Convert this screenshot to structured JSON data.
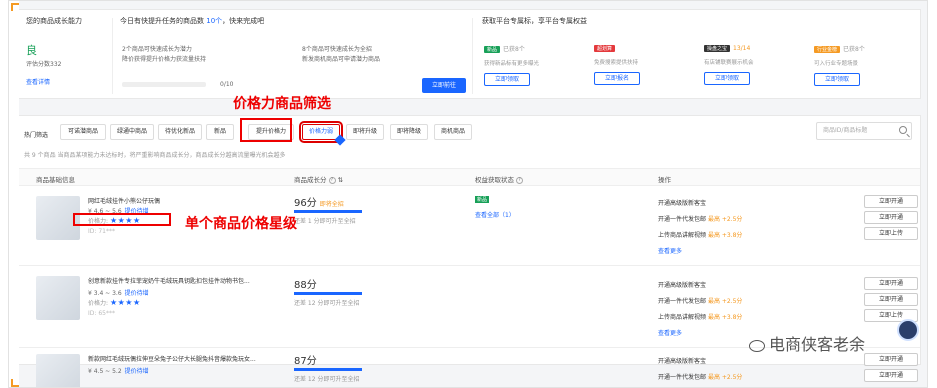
{
  "capability": {
    "title": "您的商品成长能力",
    "grade": "良",
    "score_label": "评估分数332",
    "detail_link": "查看详情"
  },
  "fast_growth": {
    "title_prefix": "今日有快提升任务的商品数",
    "count": "10个",
    "title_suffix": "，快来完成吧",
    "items": [
      "2个商品可快速成长为潜力",
      "8个商品可快速成长为全招",
      "降价获得提升价格力获流量扶持",
      "新发商机商品可申请潜力商品"
    ],
    "progress_value": 0,
    "progress_text": "0/10",
    "button": "立即前往"
  },
  "perks": {
    "title": "获取平台专属标，享平台专属权益",
    "items": [
      {
        "tag": "新品",
        "tag_color": "#18a058",
        "status": "已获8个",
        "highlight": "",
        "desc": "获得新品标有更多曝光",
        "button": "立即领取"
      },
      {
        "tag": "超划算",
        "tag_color": "#e4393c",
        "status": "",
        "highlight": "",
        "desc": "免费搜索提供扶持",
        "button": "立即报名"
      },
      {
        "tag": "操盘之宝",
        "tag_color": "#333333",
        "status": "13/14",
        "highlight": "13/14",
        "desc": "有店铺联赛展示机会",
        "button": "立即领取"
      },
      {
        "tag": "行业金榜",
        "tag_color": "#f59a23",
        "status": "已获8个",
        "highlight": "",
        "desc": "可入行业专题场景",
        "button": "立即领取"
      }
    ]
  },
  "filters": {
    "label": "热门筛选",
    "chips": [
      "可诺潜商品",
      "绿通中商品",
      "待优化新品",
      "新品",
      "提升价格力",
      "价格力弱",
      "即将升级",
      "即将降级",
      "商机商品"
    ],
    "highlighted_index": 4,
    "active_index": 5,
    "search_placeholder": "商品ID/商品标题",
    "count_text": "共 9 个商品 当商品某项能力未达标时，将严重影响商品成长分，商品成长分越高流量曝光机会越多"
  },
  "table": {
    "headers": [
      "商品基础信息",
      "商品成长分",
      "权益获取状态",
      "操作"
    ],
    "rows": [
      {
        "name": "网红毛绒挂件小熊公仔玩偶",
        "price": "¥ 4.6 ~ 5.6",
        "price_tip": "提价待增",
        "stars_label": "价格力:",
        "stars": "★★★★",
        "id": "ID: 71***",
        "score": "96分",
        "score_hot": "即将全招",
        "score_note": "还差 1 分即可升至全招",
        "rights_tag": "新品",
        "rights_link": "查看全部（1）",
        "ops": [
          {
            "text": "开通高级版新客宝",
            "hl": ""
          },
          {
            "text": "开通一件代发包邮",
            "hl": "最高 +2.5分"
          },
          {
            "text": "上传商品讲解视频",
            "hl": "最高 +3.8分"
          }
        ],
        "more": "查看更多",
        "buttons": [
          "立即开通",
          "立即开通",
          "立即上传"
        ]
      },
      {
        "name": "创意新款挂件专拉菲宠奶牛毛绒玩具钥匙扣包挂件动物书包...",
        "price": "¥ 3.4 ~ 3.6",
        "price_tip": "提价待增",
        "stars_label": "价格力:",
        "stars": "★★★★",
        "id": "ID: 65***",
        "score": "88分",
        "score_hot": "",
        "score_note": "还差 12 分即可升至全招",
        "rights_tag": "",
        "rights_link": "",
        "ops": [
          {
            "text": "开通高级版新客宝",
            "hl": ""
          },
          {
            "text": "开通一件代发包邮",
            "hl": "最高 +2.5分"
          },
          {
            "text": "上传商品讲解视频",
            "hl": "最高 +3.8分"
          }
        ],
        "more": "查看更多",
        "buttons": [
          "立即开通",
          "立即开通",
          "立即上传"
        ]
      },
      {
        "name": "新款网红毛绒玩偶拉伸豆朵兔子公仔大长腿兔抖音爆款兔玩女...",
        "price": "¥ 4.5 ~ 5.2",
        "price_tip": "提价待增",
        "stars_label": "",
        "stars": "",
        "id": "",
        "score": "87分",
        "score_hot": "",
        "score_note": "还差 12 分即可升至全招",
        "rights_tag": "",
        "rights_link": "",
        "ops": [
          {
            "text": "开通高级版新客宝",
            "hl": ""
          },
          {
            "text": "开通一件代发包邮",
            "hl": "最高 +2.5分"
          }
        ],
        "more": "",
        "buttons": [
          "立即开通",
          "立即开通"
        ]
      }
    ]
  },
  "annotations": {
    "filter_callout": "价格力商品筛选",
    "star_callout": "单个商品价格星级"
  },
  "watermark": "电商侠客老余",
  "colors": {
    "accent": "#1a66ff",
    "highlight": "#e00000",
    "warn": "#f59a23",
    "good": "#18a058"
  }
}
